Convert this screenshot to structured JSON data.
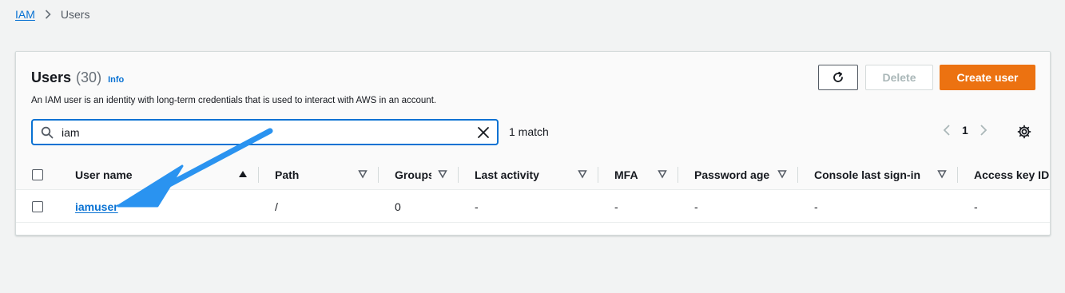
{
  "breadcrumb": {
    "root": "IAM",
    "current": "Users"
  },
  "panel": {
    "title": "Users",
    "count": "(30)",
    "info": "Info",
    "description": "An IAM user is an identity with long-term credentials that is used to interact with AWS in an account.",
    "delete_label": "Delete",
    "create_label": "Create user"
  },
  "search": {
    "value": "iam",
    "match_text": "1 match"
  },
  "pagination": {
    "page": "1"
  },
  "table": {
    "columns": [
      "User name",
      "Path",
      "Groups",
      "Last activity",
      "MFA",
      "Password age",
      "Console last sign-in",
      "Access key ID"
    ],
    "rows": [
      {
        "user_name": "iamuser",
        "path": "/",
        "groups": "0",
        "last_activity": "-",
        "mfa": "-",
        "password_age": "-",
        "console_last_sign_in": "-",
        "access_key_id": "-"
      }
    ]
  },
  "colors": {
    "accent": "#0972d3",
    "primary_button": "#ec7211",
    "annotation_arrow": "#2a93f0"
  }
}
